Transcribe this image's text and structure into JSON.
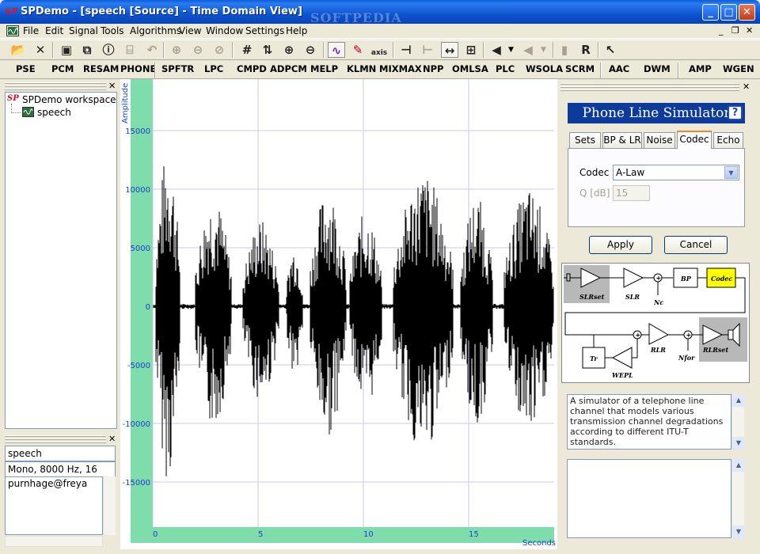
{
  "titlebar": {
    "title": "SPDemo - [speech [Source] - Time Domain View]",
    "app_logo": "SP",
    "watermark": "SOFTPEDIA",
    "min": "_",
    "max": "□",
    "close": "✕"
  },
  "menu": [
    "File",
    "Edit",
    "Signal",
    "Tools",
    "Algorithms",
    "View",
    "Window",
    "Settings",
    "Help"
  ],
  "mdi_controls": [
    "_",
    "❐",
    "✕"
  ],
  "toolbar_icons": [
    "open-icon",
    "close-file-icon",
    "save-icon",
    "copy-icon",
    "info-icon",
    "properties-icon",
    "undo-icon",
    "zoom-in-icon",
    "zoom-out-icon",
    "zoom-fit-icon",
    "grid-icon",
    "amplitude-scale-icon",
    "zoom-x-in-icon",
    "zoom-x-out-icon",
    "waveform-view-icon",
    "axis-edit-icon",
    "axis-icon",
    "marker-left-icon",
    "marker-right-icon",
    "selection-icon",
    "fit-selection-icon",
    "speaker-icon",
    "speaker-dim-icon",
    "record-icon",
    "r-icon",
    "help-pointer-icon"
  ],
  "toolbar_axis_label": "axis",
  "toolbar_r_label": "R",
  "algorithms": [
    "PSE",
    "PCM",
    "RESAM",
    "PHONE",
    "SPFTR",
    "LPC",
    "CMPD",
    "ADPCM",
    "MELP",
    "KLMN",
    "MIXMAX",
    "NPP",
    "OMLSA",
    "PLC",
    "WSOLA",
    "SCRM",
    "AAC",
    "DWM",
    "AMP",
    "WGEN"
  ],
  "workspace": {
    "root": "SPDemo workspace",
    "child": "speech"
  },
  "info_panel": {
    "name": "speech",
    "format": "Mono, 8000 Hz, 16",
    "user": "purnhage@freya"
  },
  "plot": {
    "ylabel": "Amplitude",
    "xlabel": "Seconds",
    "y_ticks": [
      "15000",
      "10000",
      "5000",
      "0",
      "-5000",
      "-10000",
      "-15000"
    ],
    "x_ticks": [
      "0",
      "5",
      "10",
      "15"
    ],
    "colors": {
      "axis_band": "#7fdcab",
      "tick_text": "#1a3fd6",
      "grid": "#c8c8e8",
      "wave": "#000000"
    }
  },
  "simulator": {
    "title": "Phone Line Simulator",
    "help": "?",
    "tabs": [
      "Sets",
      "BP & LR",
      "Noise",
      "Codec",
      "Echo"
    ],
    "active_tab": "Codec",
    "codec_label": "Codec",
    "codec_value": "A-Law",
    "q_label": "Q [dB]",
    "q_value": "15",
    "apply": "Apply",
    "cancel": "Cancel",
    "description": "A simulator of a telephone line channel that models various transmission channel degradations according to different ITU-T standards.",
    "diagram_labels": {
      "slrset": "SLRset",
      "slr": "SLR",
      "nc": "Nc",
      "bp": "BP",
      "codec": "Codec",
      "rlr": "RLR",
      "nfor": "Nfor",
      "rlrset": "RLRset",
      "tr": "Tr",
      "wepl": "WEPL"
    }
  }
}
